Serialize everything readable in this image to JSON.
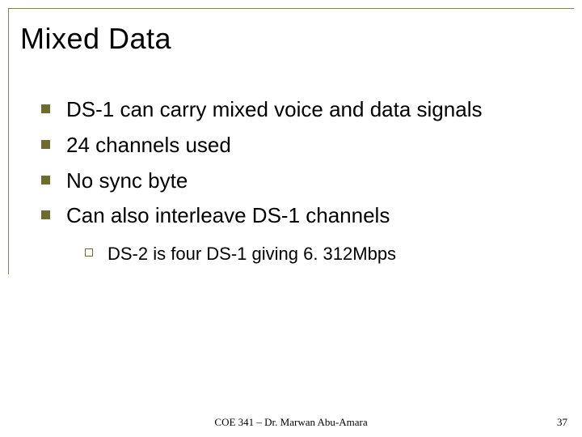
{
  "title": "Mixed Data",
  "bullets": [
    "DS-1 can carry mixed voice and data signals",
    "24 channels used",
    "No sync byte",
    "Can also interleave DS-1 channels"
  ],
  "sub_bullets": [
    "DS-2 is four DS-1 giving 6. 312Mbps"
  ],
  "footer_center": "COE 341 – Dr. Marwan Abu-Amara",
  "footer_right": "37"
}
